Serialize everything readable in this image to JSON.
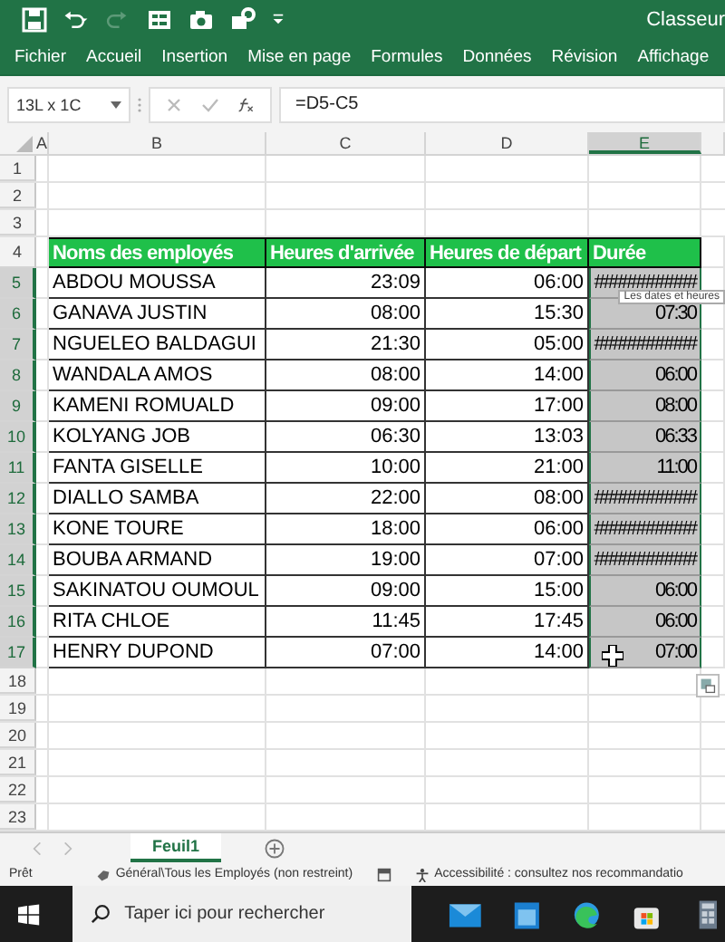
{
  "title_bar": {
    "title": "Classeur"
  },
  "ribbon_tabs": [
    "Fichier",
    "Accueil",
    "Insertion",
    "Mise en page",
    "Formules",
    "Données",
    "Révision",
    "Affichage"
  ],
  "formula_bar": {
    "name_box": "13L x 1C",
    "formula": "=D5-C5"
  },
  "sheet": {
    "columns": [
      {
        "label": "A",
        "selected": false
      },
      {
        "label": "B",
        "selected": false
      },
      {
        "label": "C",
        "selected": false
      },
      {
        "label": "D",
        "selected": false
      },
      {
        "label": "E",
        "selected": true
      }
    ],
    "rows": [
      {
        "number": "1",
        "selected": false,
        "kind": "empty"
      },
      {
        "number": "2",
        "selected": false,
        "kind": "empty"
      },
      {
        "number": "3",
        "selected": false,
        "kind": "empty"
      },
      {
        "number": "4",
        "selected": false,
        "kind": "header",
        "cells": [
          "Noms des employés",
          "Heures d'arrivée",
          "Heures de départ",
          "Durée"
        ]
      },
      {
        "number": "5",
        "selected": true,
        "kind": "data",
        "cells": [
          "ABDOU MOUSSA",
          "23:09",
          "06:00",
          "###########"
        ]
      },
      {
        "number": "6",
        "selected": true,
        "kind": "data",
        "cells": [
          "GANAVA JUSTIN",
          "08:00",
          "15:30",
          "07:30"
        ]
      },
      {
        "number": "7",
        "selected": true,
        "kind": "data",
        "cells": [
          "NGUELEO BALDAGUI",
          "21:30",
          "05:00",
          "###########"
        ]
      },
      {
        "number": "8",
        "selected": true,
        "kind": "data",
        "cells": [
          "WANDALA AMOS",
          "08:00",
          "14:00",
          "06:00"
        ]
      },
      {
        "number": "9",
        "selected": true,
        "kind": "data",
        "cells": [
          "KAMENI ROMUALD",
          "09:00",
          "17:00",
          "08:00"
        ]
      },
      {
        "number": "10",
        "selected": true,
        "kind": "data",
        "cells": [
          "KOLYANG JOB",
          "06:30",
          "13:03",
          "06:33"
        ]
      },
      {
        "number": "11",
        "selected": true,
        "kind": "data",
        "cells": [
          "FANTA GISELLE",
          "10:00",
          "21:00",
          "11:00"
        ]
      },
      {
        "number": "12",
        "selected": true,
        "kind": "data",
        "cells": [
          "DIALLO SAMBA",
          "22:00",
          "08:00",
          "###########"
        ]
      },
      {
        "number": "13",
        "selected": true,
        "kind": "data",
        "cells": [
          "KONE TOURE",
          "18:00",
          "06:00",
          "###########"
        ]
      },
      {
        "number": "14",
        "selected": true,
        "kind": "data",
        "cells": [
          "BOUBA ARMAND",
          "19:00",
          "07:00",
          "###########"
        ]
      },
      {
        "number": "15",
        "selected": true,
        "kind": "data",
        "cells": [
          "SAKINATOU OUMOUL",
          "09:00",
          "15:00",
          "06:00"
        ]
      },
      {
        "number": "16",
        "selected": true,
        "kind": "data",
        "cells": [
          "RITA CHLOE",
          "11:45",
          "17:45",
          "06:00"
        ]
      },
      {
        "number": "17",
        "selected": true,
        "kind": "data",
        "cells": [
          "HENRY DUPOND",
          "07:00",
          "14:00",
          "07:00"
        ]
      },
      {
        "number": "18",
        "selected": false,
        "kind": "empty"
      },
      {
        "number": "19",
        "selected": false,
        "kind": "empty"
      },
      {
        "number": "20",
        "selected": false,
        "kind": "empty"
      },
      {
        "number": "21",
        "selected": false,
        "kind": "empty"
      },
      {
        "number": "22",
        "selected": false,
        "kind": "empty"
      },
      {
        "number": "23",
        "selected": false,
        "kind": "empty"
      }
    ]
  },
  "tooltip": "Les dates et heures",
  "sheet_tabs": [
    {
      "label": "Feuil1",
      "selected": true
    }
  ],
  "status_bar": {
    "mode": "Prêt",
    "sensitivity": "Général\\Tous les Employés (non restreint)",
    "accessibility": "Accessibilité : consultez nos recommandatio"
  },
  "taskbar": {
    "search_placeholder": "Taper ici pour rechercher"
  }
}
